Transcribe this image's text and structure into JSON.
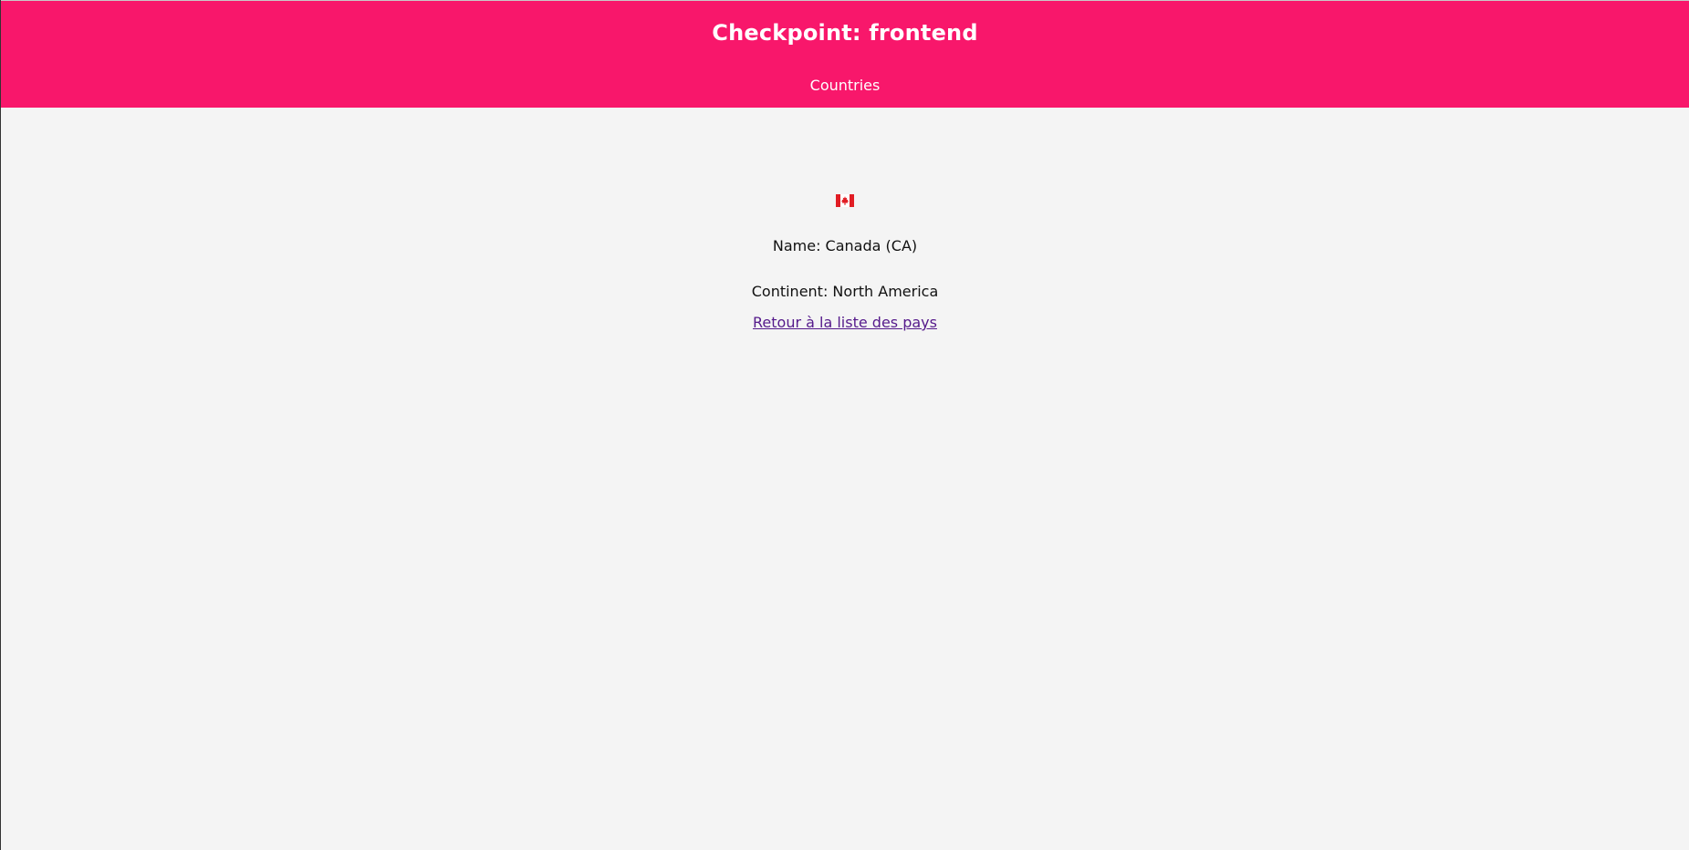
{
  "header": {
    "title": "Checkpoint: frontend",
    "nav_link": "Countries"
  },
  "country": {
    "flag_icon": "canada-flag-icon",
    "name_text": "Name: Canada (CA)",
    "continent_text": "Continent: North America",
    "back_link": "Retour à la liste des pays"
  },
  "colors": {
    "header_background": "#f8176b",
    "page_background": "#f4f4f4",
    "link_color": "#551a8b"
  }
}
